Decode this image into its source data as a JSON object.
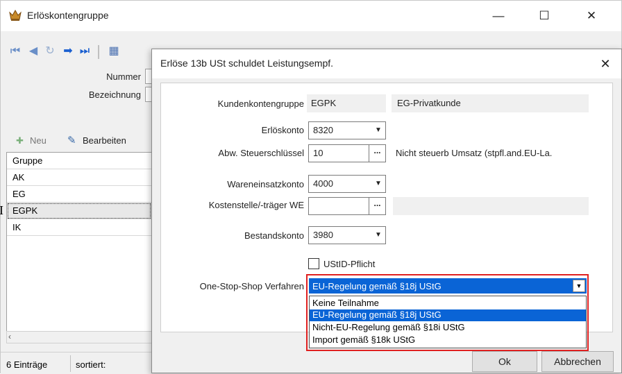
{
  "outer_window": {
    "title": "Erlöskontengruppe",
    "minimize": "—",
    "maximize": "☐",
    "close": "✕"
  },
  "outer_form": {
    "nummer_label": "Nummer",
    "bezeichnung_label": "Bezeichnung"
  },
  "grid_toolbar": {
    "new_label": "Neu",
    "edit_label": "Bearbeiten"
  },
  "grid": {
    "header": "Gruppe",
    "rows": [
      "AK",
      "EG",
      "EGPK",
      "IK"
    ],
    "current_marker": "I"
  },
  "status": {
    "count": "6 Einträge",
    "sort": "sortiert:"
  },
  "dialog": {
    "title": "Erlöse 13b USt schuldet Leistungsempf.",
    "close": "✕",
    "kundenkontengruppe_label": "Kundenkontengruppe",
    "kundenkontengruppe_code": "EGPK",
    "kundenkontengruppe_name": "EG-Privatkunde",
    "erloeskonto_label": "Erlöskonto",
    "erloeskonto_value": "8320",
    "steuerschluessel_label": "Abw. Steuerschlüssel",
    "steuerschluessel_value": "10",
    "steuerschluessel_text": "Nicht steuerb Umsatz (stpfl.and.EU-La.",
    "wareneinsatz_label": "Wareneinsatzkonto",
    "wareneinsatz_value": "4000",
    "kostenstelle_label": "Kostenstelle/-träger WE",
    "kostenstelle_value": "",
    "bestandskonto_label": "Bestandskonto",
    "bestandskonto_value": "3980",
    "ustid_label": "UStID-Pflicht",
    "oss_label": "One-Stop-Shop Verfahren",
    "oss_selected": "EU-Regelung gemäß §18j UStG",
    "oss_options": [
      "Keine Teilnahme",
      "EU-Regelung gemäß §18j UStG",
      "Nicht-EU-Regelung gemäß §18i UStG",
      "Import gemäß §18k UStG"
    ],
    "ok_label": "Ok",
    "cancel_label": "Abbrechen"
  },
  "colors": {
    "selection": "#0a64d6",
    "highlight": "#e02020"
  }
}
